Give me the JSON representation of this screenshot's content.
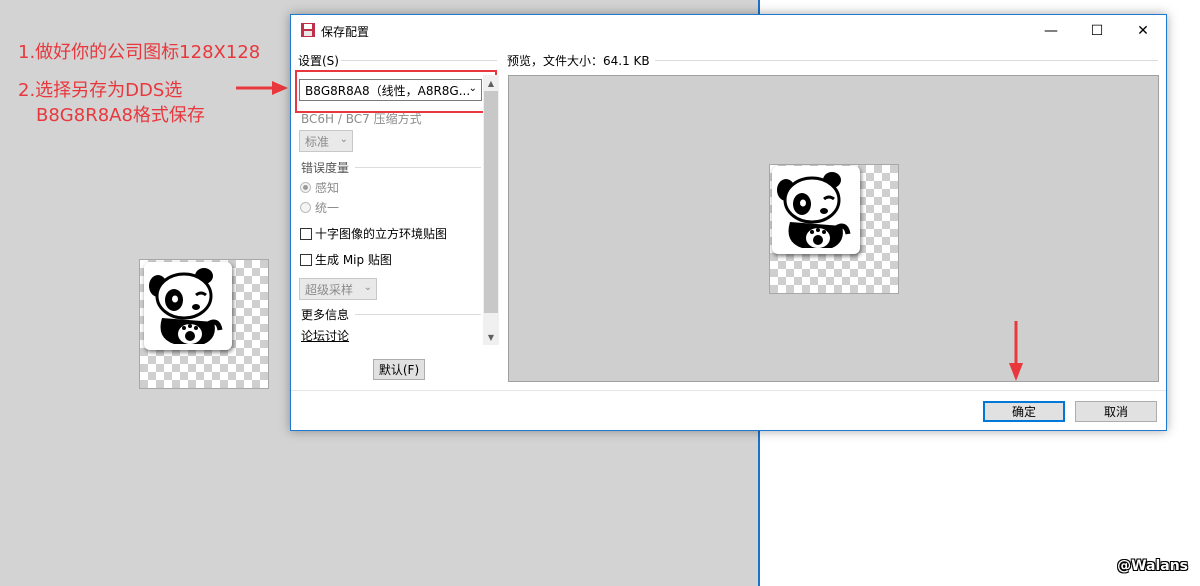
{
  "annotations": {
    "step1": "1.做好你的公司图标128X128",
    "step2_line1": "2.选择另存为DDS选",
    "step2_line2": "B8G8R8A8格式保存",
    "color": "#e8383d"
  },
  "dialog": {
    "title": "保存配置",
    "minimize_glyph": "—",
    "maximize_glyph": "☐",
    "close_glyph": "✕",
    "settings_label": "设置(S)",
    "format_value": "B8G8R8A8（线性，A8R8G...",
    "compression_label": "BC6H / BC7 压缩方式",
    "compression_value": "标准",
    "error_metric_label": "错误度量",
    "radio_perceptual": "感知",
    "radio_uniform": "统一",
    "cubemap_label": "十字图像的立方环境贴图",
    "mipmap_label": "生成 Mip 贴图",
    "supersample_value": "超级采样",
    "more_info_label": "更多信息",
    "forum_link": "论坛讨论",
    "default_button": "默认(F)",
    "preview_label": "预览，文件大小：64.1 KB",
    "ok_button": "确定",
    "cancel_button": "取消",
    "accent_color": "#0078d7"
  },
  "watermark": "@Walans"
}
